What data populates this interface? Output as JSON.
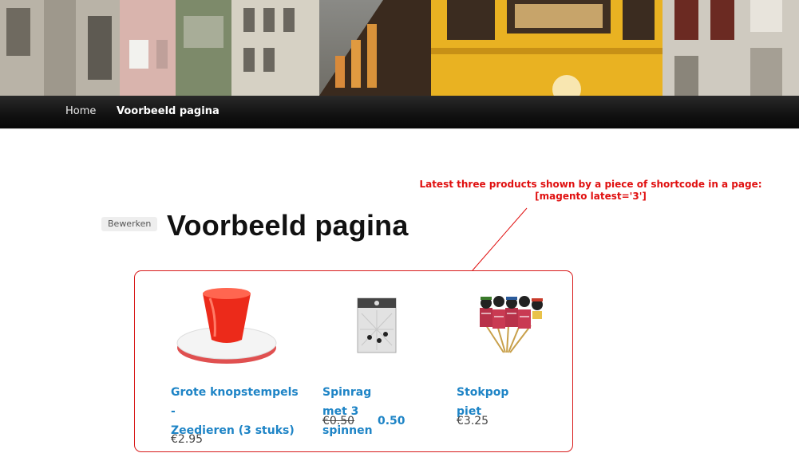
{
  "header": {
    "image": "street-with-yellow-tram-photo"
  },
  "nav": {
    "items": [
      {
        "label": "Home"
      },
      {
        "label": "Voorbeeld pagina"
      }
    ]
  },
  "annotation": {
    "line1": "Latest three products shown by a piece of shortcode in a page:",
    "line2": "[magento latest='3']"
  },
  "page": {
    "edit_label": "Bewerken",
    "title": "Voorbeeld pagina"
  },
  "products": [
    {
      "name_line1": "Grote knopstempels -",
      "name_line2": "Zeedieren (3 stuks)",
      "price": "€2.95",
      "image": "red-stamp-product-image"
    },
    {
      "name": "Spinrag met 3 spinnen",
      "old_price": "€0.50",
      "special_price": "0.50",
      "image": "spider-web-package-product-image"
    },
    {
      "name": "Stokpop piet",
      "price": "€3.25",
      "image": "stick-puppet-product-image"
    }
  ],
  "colors": {
    "annotation": "#e01010",
    "link": "#1e84c6",
    "nav_bg": "#111111"
  }
}
